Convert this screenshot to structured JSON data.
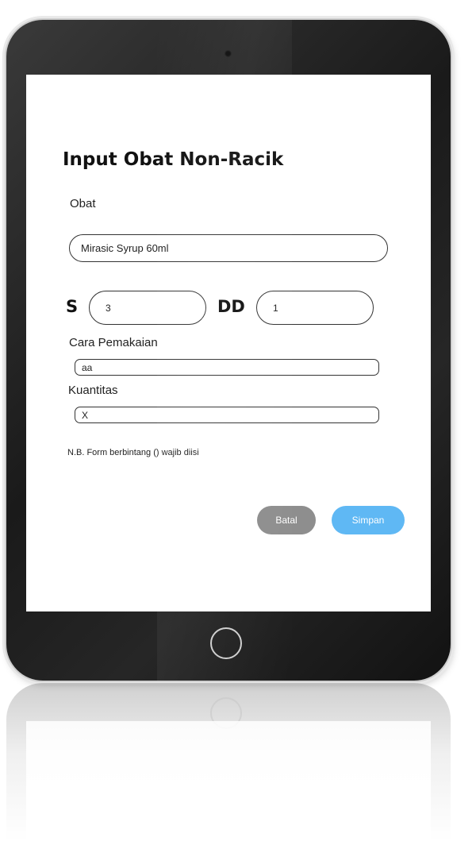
{
  "form": {
    "title": "Input Obat Non-Racik",
    "obat": {
      "label": "Obat",
      "value": "Mirasic Syrup 60ml"
    },
    "dosage": {
      "s_label": "S",
      "s_value": "3",
      "dd_label": "DD",
      "dd_value": "1"
    },
    "cara_pemakaian": {
      "label": "Cara Pemakaian",
      "value": "aa"
    },
    "kuantitas": {
      "label": "Kuantitas",
      "value": "X"
    },
    "note": "N.B. Form berbintang () wajib diisi",
    "buttons": {
      "cancel_label": "Batal",
      "save_label": "Simpan"
    }
  },
  "colors": {
    "cancel_button": "#8e8e8e",
    "save_button": "#5fb8f4",
    "device_bezel": "#1f1f1f"
  }
}
